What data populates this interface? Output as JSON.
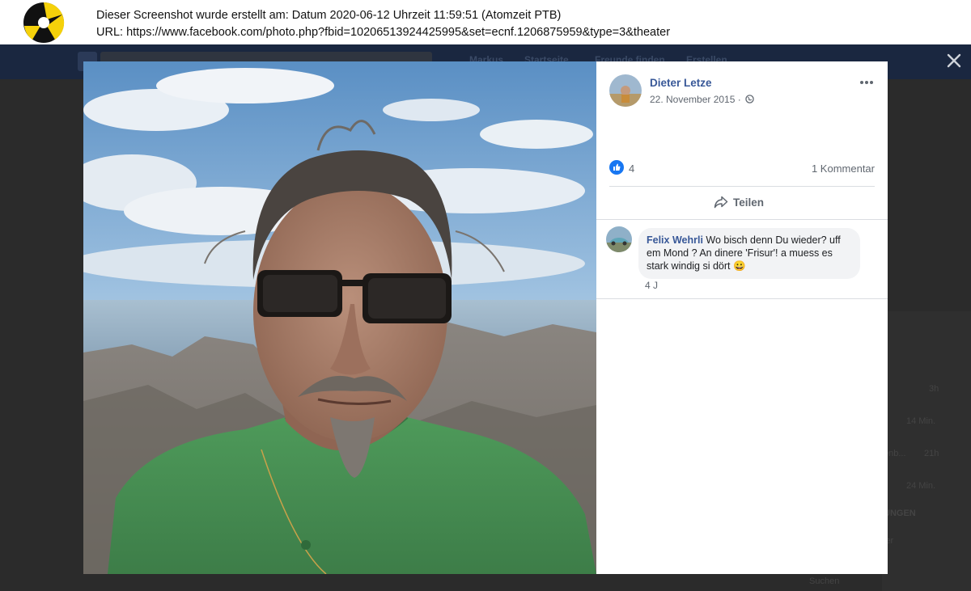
{
  "capture": {
    "line1": "Dieser Screenshot wurde erstellt am: Datum 2020-06-12 Uhrzeit 11:59:51 (Atomzeit PTB)",
    "line2": "URL: https://www.facebook.com/photo.php?fbid=10206513924425995&set=ecnf.1206875959&type=3&theater"
  },
  "background": {
    "nav": [
      "Markus",
      "Startseite",
      "Freunde finden",
      "Erstellen"
    ],
    "ghost_times": [
      "3h",
      "14 Min.",
      "21h",
      "24 Min."
    ],
    "ghost_text": [
      "enb...",
      "UNGEN",
      "ler",
      "Suchen"
    ]
  },
  "post": {
    "author": "Dieter Letze",
    "date": "22. November 2015 ·",
    "like_count": "4",
    "comment_count": "1 Kommentar",
    "share_label": "Teilen"
  },
  "comment": {
    "author": "Felix Wehrli",
    "text": " Wo bisch denn Du wieder? uff em Mond ? An dinere 'Frisur'! a muess es stark windig si dört 😀",
    "time": "4 J"
  },
  "colors": {
    "link": "#385898",
    "meta": "#606770",
    "like_blue": "#1877f2"
  }
}
